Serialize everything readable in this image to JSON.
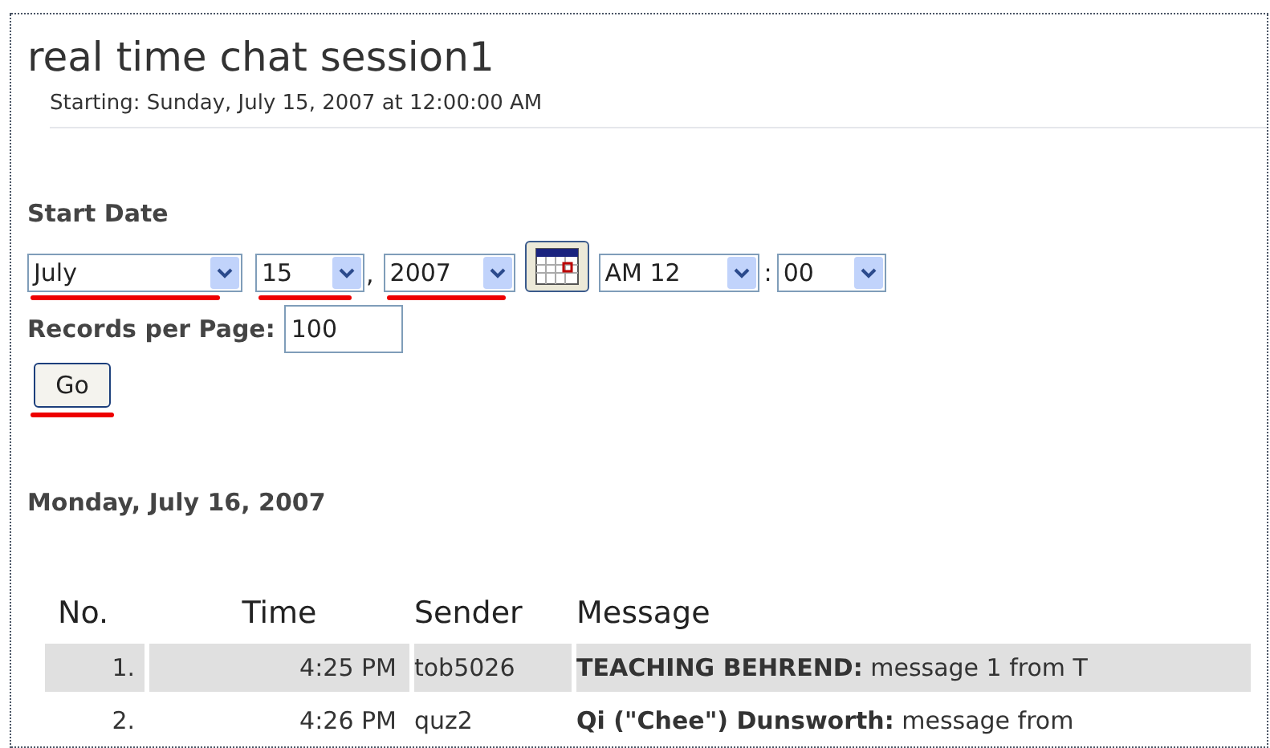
{
  "title": "real time chat session1",
  "subtitle": "Starting: Sunday, July 15, 2007 at 12:00:00 AM",
  "start_date": {
    "label": "Start Date",
    "month": "July",
    "day": "15",
    "separator": ",",
    "year": "2007",
    "hour": "AM 12",
    "time_separator": ":",
    "minute": "00"
  },
  "records": {
    "label": "Records per Page:",
    "value": "100"
  },
  "go_button": "Go",
  "day_heading": "Monday, July 16, 2007",
  "table": {
    "columns": [
      "No.",
      "Time",
      "Sender",
      "Message"
    ],
    "rows": [
      {
        "no": "1.",
        "time": "4:25 PM",
        "sender": "tob5026",
        "message": "**TEACHING BEHREND:** message 1 from T",
        "selected": true
      },
      {
        "no": "2.",
        "time": "4:26 PM",
        "sender": "quz2",
        "message": "**Qi (\"Chee\") Dunsworth:** message from",
        "selected": false
      }
    ]
  }
}
